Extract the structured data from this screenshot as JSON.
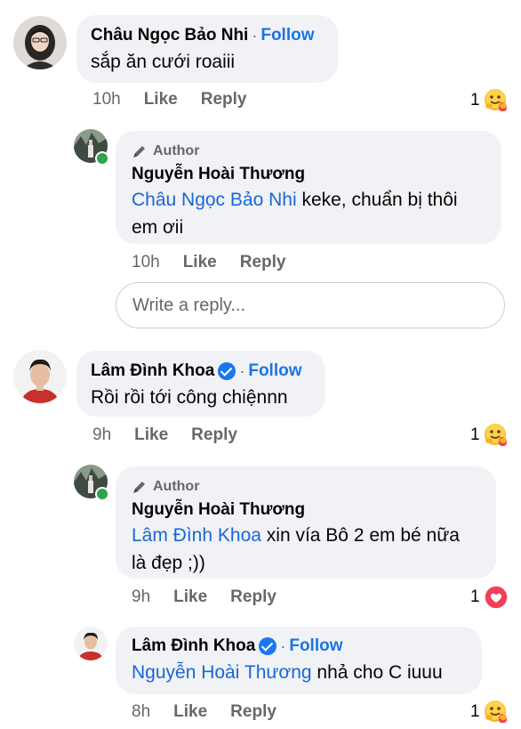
{
  "comments": [
    {
      "name": "Châu Ngọc Bảo Nhi",
      "follow": "Follow",
      "text": "sắp ăn cưới roaiii",
      "time": "10h",
      "like": "Like",
      "reply": "Reply",
      "reactions": "1",
      "reaction_icon": "hug-emoji-icon",
      "replies": [
        {
          "badge": "Author",
          "name": "Nguyễn Hoài Thương",
          "mention": "Châu Ngọc Bảo Nhi",
          "text_line1": " keke, chuẩn bị thôi",
          "text_line2": "em ơii",
          "time": "10h",
          "like": "Like",
          "reply": "Reply"
        }
      ],
      "reply_placeholder": "Write a reply..."
    },
    {
      "name": "Lâm Đình Khoa",
      "follow": "Follow",
      "text": "Rồi rồi tới công chiệnnn",
      "time": "9h",
      "like": "Like",
      "reply": "Reply",
      "reactions": "1",
      "reaction_icon": "hug-emoji-icon",
      "replies": [
        {
          "badge": "Author",
          "name": "Nguyễn Hoài Thương",
          "mention": "Lâm Đình Khoa",
          "text_line1": " xin vía Bô 2 em bé nữa",
          "text_line2": "là đẹp ;))",
          "time": "9h",
          "like": "Like",
          "reply": "Reply",
          "reactions": "1",
          "reaction_icon": "heart-icon"
        },
        {
          "name": "Lâm Đình Khoa",
          "follow": "Follow",
          "mention": "Nguyễn Hoài Thương",
          "text_line1": " nhả cho C iuuu",
          "time": "8h",
          "like": "Like",
          "reply": "Reply",
          "reactions": "1",
          "reaction_icon": "hug-emoji-icon"
        }
      ]
    }
  ],
  "colors": {
    "link": "#1a66d6",
    "follow": "#1b74e4",
    "bubble": "#f0f2f5",
    "meta": "#65676b",
    "verified": "#1877f2",
    "online": "#31a24c",
    "heart": "#f33e58"
  }
}
